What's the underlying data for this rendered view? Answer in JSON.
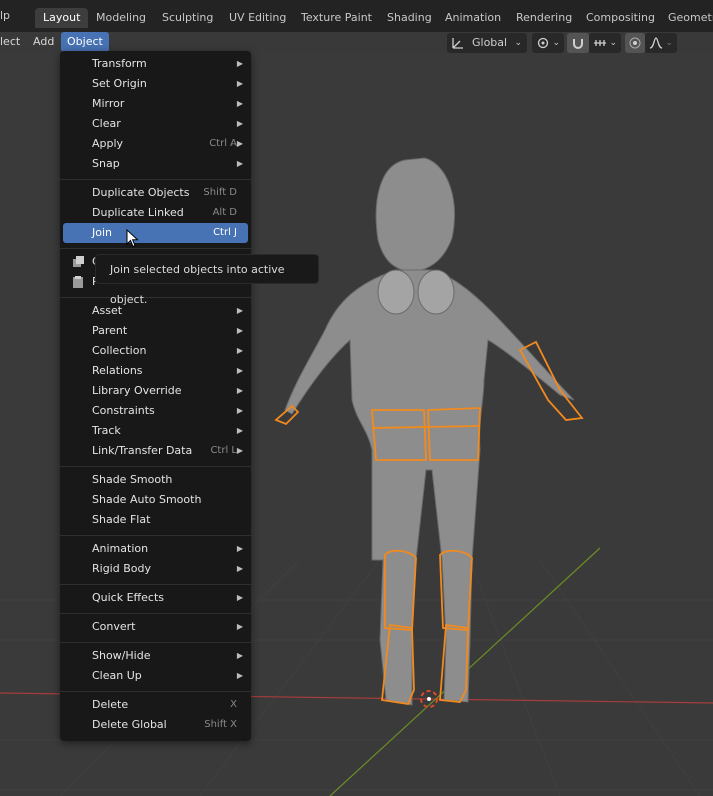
{
  "app": {
    "help_menu_partial": "lp",
    "workspace_tabs": [
      {
        "label": "Layout",
        "active": true
      },
      {
        "label": "Modeling"
      },
      {
        "label": "Sculpting"
      },
      {
        "label": "UV Editing"
      },
      {
        "label": "Texture Paint"
      },
      {
        "label": "Shading"
      },
      {
        "label": "Animation"
      },
      {
        "label": "Rendering"
      },
      {
        "label": "Compositing"
      },
      {
        "label": "Geometr"
      }
    ]
  },
  "header": {
    "menus": [
      {
        "label": "lect"
      },
      {
        "label": "Add"
      },
      {
        "label": "Object",
        "active": true
      }
    ],
    "transform_orientation": "Global"
  },
  "object_menu": {
    "items": [
      {
        "label": "Transform",
        "submenu": true
      },
      {
        "label": "Set Origin",
        "submenu": true
      },
      {
        "label": "Mirror",
        "submenu": true
      },
      {
        "label": "Clear",
        "submenu": true
      },
      {
        "label": "Apply",
        "shortcut": "Ctrl A",
        "submenu": true
      },
      {
        "label": "Snap",
        "submenu": true
      },
      {
        "label": "Duplicate Objects",
        "shortcut": "Shift D"
      },
      {
        "label": "Duplicate Linked",
        "shortcut": "Alt D"
      },
      {
        "label": "Join",
        "shortcut": "Ctrl J",
        "highlighted": true
      },
      {
        "label": "C",
        "icon": "copy-icon"
      },
      {
        "label": "P",
        "icon": "paste-icon"
      },
      {
        "label": "Asset",
        "submenu": true
      },
      {
        "label": "Parent",
        "submenu": true
      },
      {
        "label": "Collection",
        "submenu": true
      },
      {
        "label": "Relations",
        "submenu": true
      },
      {
        "label": "Library Override",
        "submenu": true
      },
      {
        "label": "Constraints",
        "submenu": true
      },
      {
        "label": "Track",
        "submenu": true
      },
      {
        "label": "Link/Transfer Data",
        "shortcut": "Ctrl L",
        "submenu": true
      },
      {
        "label": "Shade Smooth"
      },
      {
        "label": "Shade Auto Smooth"
      },
      {
        "label": "Shade Flat"
      },
      {
        "label": "Animation",
        "submenu": true
      },
      {
        "label": "Rigid Body",
        "submenu": true
      },
      {
        "label": "Quick Effects",
        "submenu": true
      },
      {
        "label": "Convert",
        "submenu": true
      },
      {
        "label": "Show/Hide",
        "submenu": true
      },
      {
        "label": "Clean Up",
        "submenu": true
      },
      {
        "label": "Delete",
        "shortcut": "X"
      },
      {
        "label": "Delete Global",
        "shortcut": "Shift X"
      }
    ]
  },
  "tooltip": {
    "text": "Join selected objects into active object."
  },
  "colors": {
    "accent": "#4772b3",
    "selection_outline": "#f28a1e",
    "x_axis": "#a63c3c",
    "y_axis": "#6b8e23"
  }
}
